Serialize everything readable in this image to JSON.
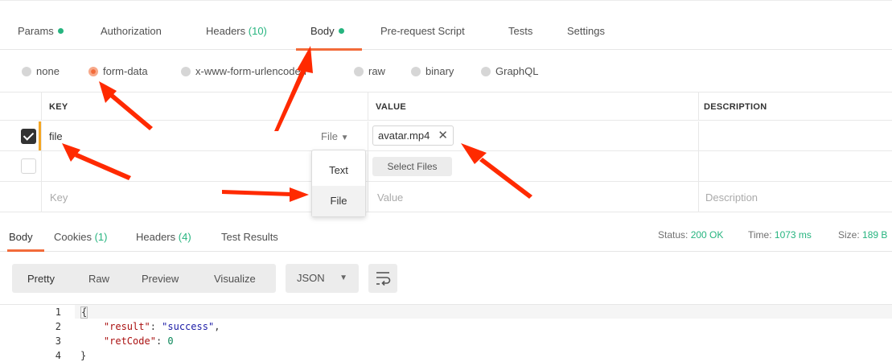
{
  "request_tabs": [
    {
      "label": "Params",
      "has_dot": true
    },
    {
      "label": "Authorization"
    },
    {
      "label": "Headers",
      "count": "(10)"
    },
    {
      "label": "Body",
      "has_dot": true,
      "active": true
    },
    {
      "label": "Pre-request Script"
    },
    {
      "label": "Tests"
    },
    {
      "label": "Settings"
    }
  ],
  "body_types": [
    "none",
    "form-data",
    "x-www-form-urlencoded",
    "raw",
    "binary",
    "GraphQL"
  ],
  "body_type_selected": "form-data",
  "kv_table": {
    "headers": {
      "key": "KEY",
      "value": "VALUE",
      "description": "DESCRIPTION"
    },
    "rows": [
      {
        "checked": true,
        "key": "file",
        "type": "File",
        "value": "avatar.mp4"
      },
      {
        "checked": false,
        "select_files_label": "Select Files"
      }
    ],
    "placeholders": {
      "key": "Key",
      "value": "Value",
      "description": "Description"
    }
  },
  "type_dropdown": {
    "options": [
      "Text",
      "File"
    ],
    "highlighted": "File"
  },
  "response": {
    "tabs": [
      {
        "label": "Body",
        "active": true
      },
      {
        "label": "Cookies",
        "count": "(1)"
      },
      {
        "label": "Headers",
        "count": "(4)"
      },
      {
        "label": "Test Results"
      }
    ],
    "status_label": "Status:",
    "status_value": "200 OK",
    "time_label": "Time:",
    "time_value": "1073 ms",
    "size_label": "Size:",
    "size_value": "189 B",
    "view_modes": [
      "Pretty",
      "Raw",
      "Preview",
      "Visualize"
    ],
    "active_view": "Pretty",
    "format": "JSON"
  },
  "code": {
    "line_numbers": [
      "1",
      "2",
      "3",
      "4"
    ],
    "line1": "{",
    "result_key": "\"result\"",
    "result_value": "\"success\"",
    "retcode_key": "\"retCode\"",
    "retcode_value": "0",
    "line4": "}"
  },
  "colors": {
    "accent": "#f26b3a",
    "green": "#26b47f",
    "arrow": "#ff2a00",
    "active_row_bar": "#f5a623"
  }
}
